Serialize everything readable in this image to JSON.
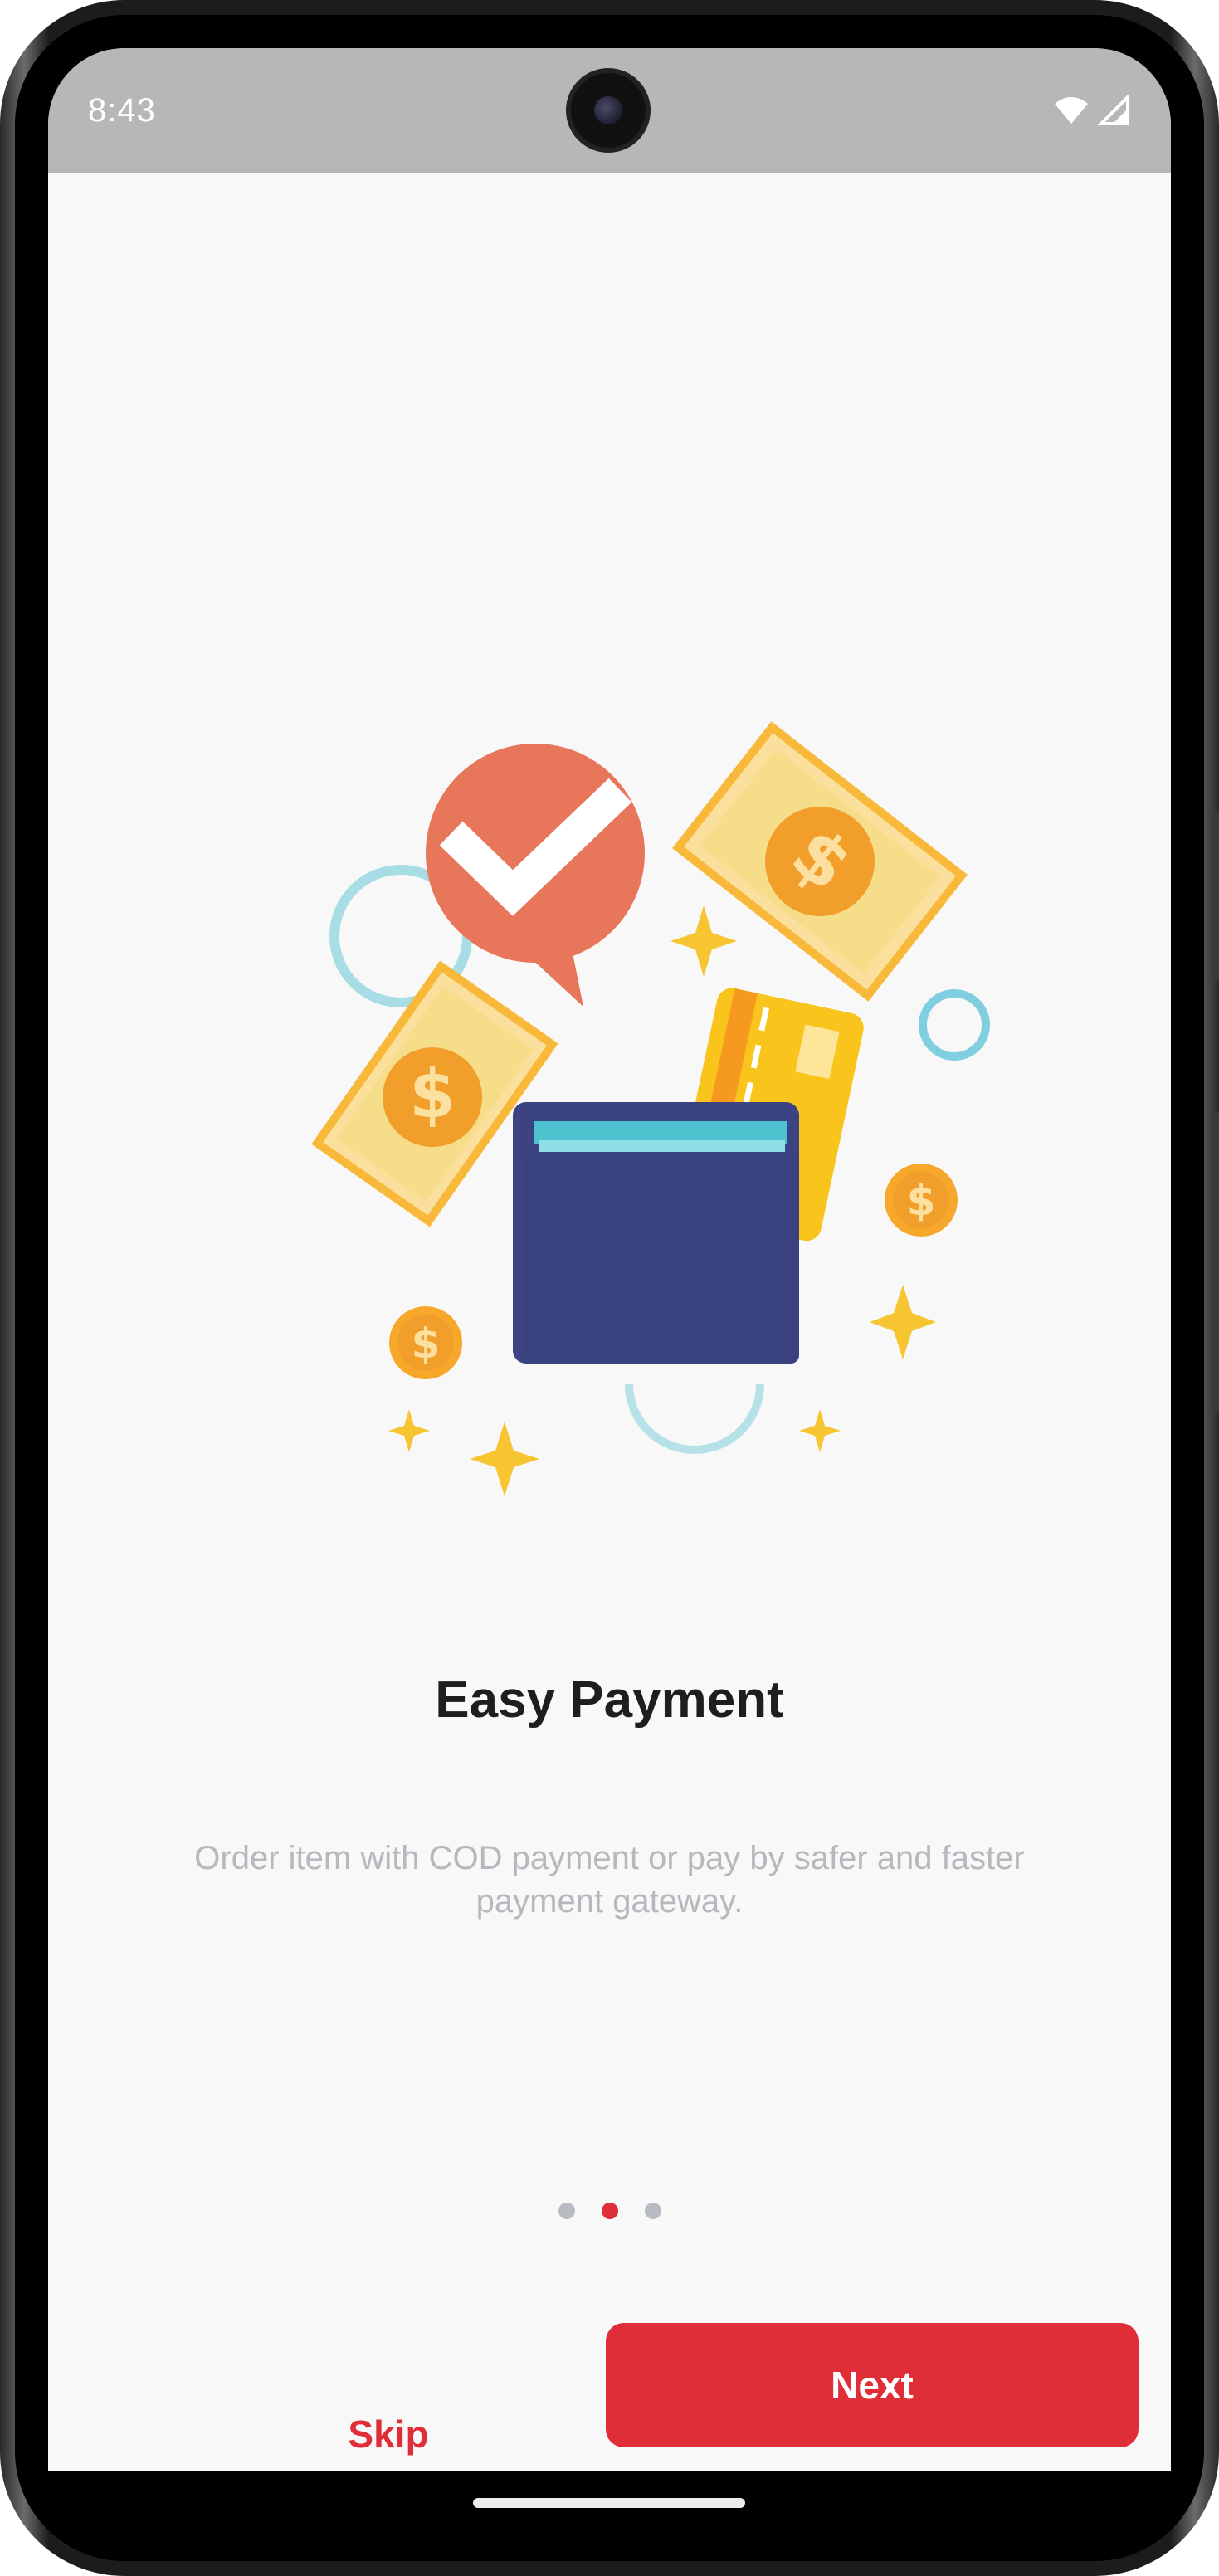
{
  "status_bar": {
    "time": "8:43",
    "wifi_icon": "wifi-icon",
    "signal_icon": "cell-signal-icon"
  },
  "onboarding": {
    "illustration_icon": "payment-wallet-illustration",
    "title": "Easy Payment",
    "subtitle": "Order item with COD payment or pay by safer and faster payment gateway.",
    "page_count": 3,
    "current_page": 2
  },
  "actions": {
    "skip_label": "Skip",
    "next_label": "Next"
  },
  "colors": {
    "accent": "#df2e38",
    "status_bar": "#b7b7b7",
    "background": "#f8f8f8"
  }
}
